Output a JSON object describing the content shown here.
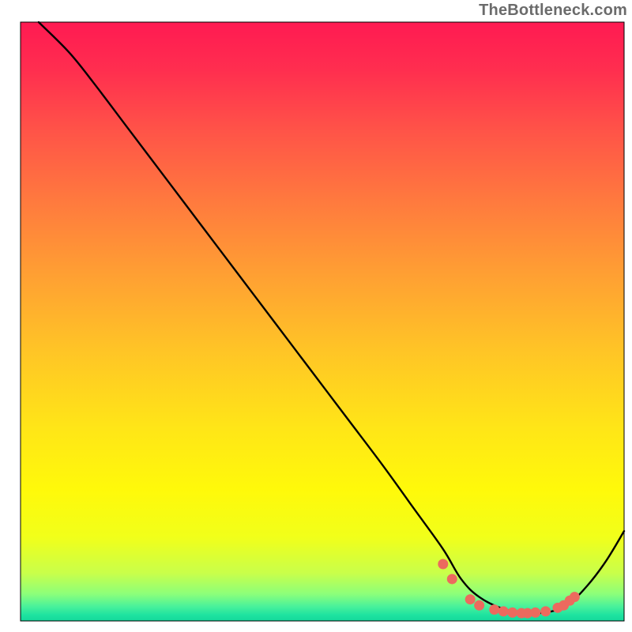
{
  "watermark": "TheBottleneck.com",
  "chart_data": {
    "type": "line",
    "title": "",
    "xlabel": "",
    "ylabel": "",
    "xlim": [
      0,
      100
    ],
    "ylim": [
      0,
      100
    ],
    "grid": false,
    "legend": false,
    "background_gradient_stops": [
      {
        "offset": 0,
        "color": "#ff1a52"
      },
      {
        "offset": 0.08,
        "color": "#ff2e4f"
      },
      {
        "offset": 0.18,
        "color": "#ff5348"
      },
      {
        "offset": 0.3,
        "color": "#ff7a3e"
      },
      {
        "offset": 0.42,
        "color": "#ff9f33"
      },
      {
        "offset": 0.55,
        "color": "#ffc526"
      },
      {
        "offset": 0.68,
        "color": "#ffe617"
      },
      {
        "offset": 0.78,
        "color": "#fff90a"
      },
      {
        "offset": 0.86,
        "color": "#f1ff1a"
      },
      {
        "offset": 0.92,
        "color": "#c9ff4a"
      },
      {
        "offset": 0.955,
        "color": "#8cff7a"
      },
      {
        "offset": 0.975,
        "color": "#4cf29a"
      },
      {
        "offset": 0.99,
        "color": "#1ee3a0"
      },
      {
        "offset": 1.0,
        "color": "#14d89b"
      }
    ],
    "series": [
      {
        "name": "bottleneck-curve",
        "color": "#000000",
        "stroke_width": 2.4,
        "x": [
          3,
          8,
          12,
          18,
          24,
          30,
          36,
          42,
          48,
          54,
          60,
          65,
          70,
          73,
          76,
          80,
          84,
          88,
          91,
          94,
          97,
          100
        ],
        "y": [
          100,
          95,
          90,
          82,
          74,
          66,
          58,
          50,
          42,
          34,
          26,
          19,
          12,
          7,
          4,
          2,
          1.3,
          1.6,
          3,
          6,
          10,
          15
        ]
      }
    ],
    "markers": {
      "name": "optimal-range-dots",
      "color": "#ec6a5e",
      "radius": 6.5,
      "x": [
        70,
        71.5,
        74.5,
        76,
        78.5,
        80,
        81.5,
        83,
        84,
        85.3,
        87,
        89,
        90,
        91,
        91.8
      ],
      "y": [
        9.5,
        7,
        3.6,
        2.6,
        1.9,
        1.6,
        1.4,
        1.3,
        1.3,
        1.4,
        1.6,
        2.2,
        2.6,
        3.4,
        4.0
      ]
    }
  }
}
